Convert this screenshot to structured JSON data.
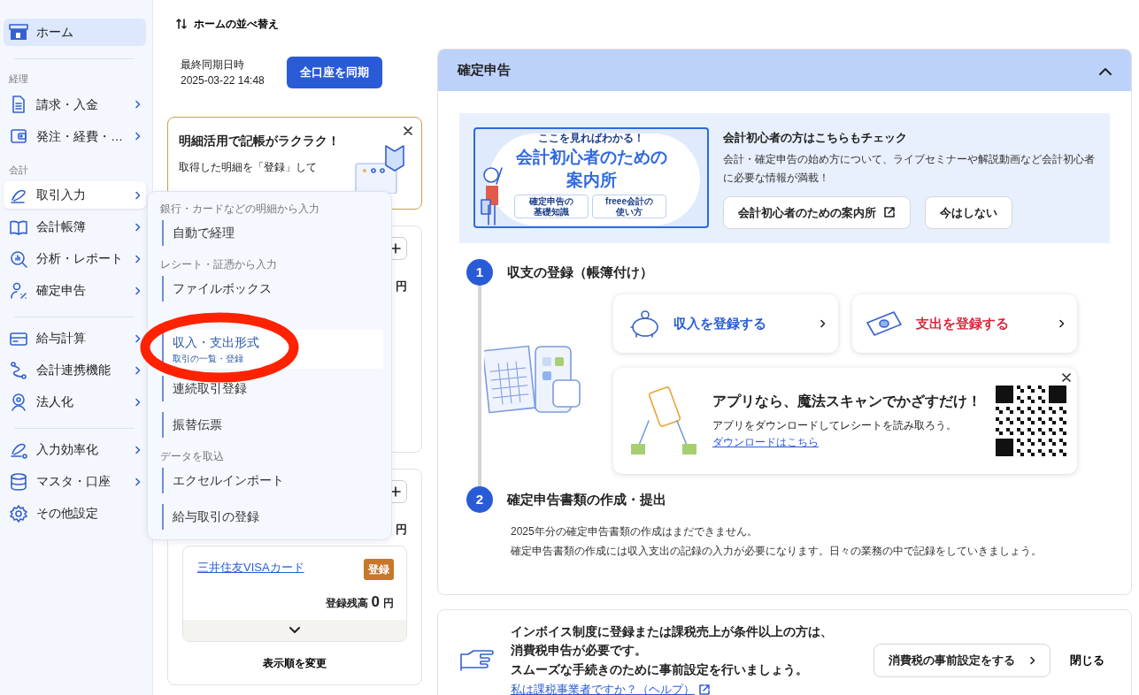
{
  "sidebar": {
    "groups": [
      {
        "items": [
          {
            "label": "ホーム",
            "selected": true,
            "expanded": false,
            "chevron": false
          }
        ]
      },
      {
        "label": "経理",
        "items": [
          {
            "label": "請求・入金",
            "selected": false,
            "expanded": false,
            "chevron": true
          },
          {
            "label": "発注・経費・…",
            "selected": false,
            "expanded": false,
            "chevron": true
          }
        ]
      },
      {
        "label": "会計",
        "items": [
          {
            "label": "取引入力",
            "selected": false,
            "expanded": true,
            "chevron": true
          },
          {
            "label": "会計帳簿",
            "selected": false,
            "expanded": false,
            "chevron": true
          },
          {
            "label": "分析・レポート",
            "selected": false,
            "expanded": false,
            "chevron": true
          },
          {
            "label": "確定申告",
            "selected": false,
            "expanded": false,
            "chevron": true
          }
        ]
      },
      {
        "items": [
          {
            "label": "給与計算",
            "selected": false,
            "expanded": false,
            "chevron": true
          },
          {
            "label": "会計連携機能",
            "selected": false,
            "expanded": false,
            "chevron": true
          },
          {
            "label": "法人化",
            "selected": false,
            "expanded": false,
            "chevron": true
          }
        ]
      },
      {
        "items": [
          {
            "label": "入力効率化",
            "selected": false,
            "expanded": false,
            "chevron": true
          },
          {
            "label": "マスタ・口座",
            "selected": false,
            "expanded": false,
            "chevron": true
          },
          {
            "label": "その他設定",
            "selected": false,
            "expanded": false,
            "chevron": false
          }
        ]
      }
    ]
  },
  "submenu": {
    "sections": [
      {
        "label": "銀行・カードなどの明細から入力",
        "items": [
          {
            "label": "自動で経理",
            "selected": false,
            "highlighted": false
          }
        ]
      },
      {
        "label": "レシート・証憑から入力",
        "items": [
          {
            "label": "ファイルボックス",
            "selected": false,
            "highlighted": false
          }
        ]
      },
      {
        "items": [
          {
            "label": "収入・支出形式",
            "sublabel": "取引の一覧・登録",
            "selected": true,
            "highlighted": true
          },
          {
            "label": "連続取引登録",
            "selected": false,
            "highlighted": false
          },
          {
            "label": "振替伝票",
            "selected": false,
            "highlighted": false
          }
        ]
      },
      {
        "label": "データを取込",
        "items": [
          {
            "label": "エクセルインポート",
            "selected": false,
            "highlighted": false
          },
          {
            "label": "給与取引の登録",
            "selected": false,
            "highlighted": false
          }
        ]
      }
    ]
  },
  "middle": {
    "sort_link": "ホームの並べ替え",
    "sync": {
      "label": "最終同期日時",
      "time": "2025-03-22 14:48",
      "button": "全口座を同期"
    },
    "banner": {
      "title": "明細活用で記帳がラクラク！",
      "text": "取得した明細を「登録」して"
    },
    "account_cards": [
      {
        "yen": "円"
      },
      {
        "yen": "円",
        "accounts": [
          {
            "name": "三井住友VISAカード",
            "badge": "登録",
            "balance_label": "登録残高",
            "balance": "0",
            "yen": "円"
          }
        ],
        "footer": "表示順を変更"
      }
    ]
  },
  "panel": {
    "title": "確定申告",
    "expanded": true,
    "guide": {
      "image": {
        "kicker": "ここを見ればわかる！",
        "title": "会計初心者のための",
        "title_2": "案内所",
        "chips": [
          {
            "lines": [
              "確定申告の",
              "基礎知識"
            ]
          },
          {
            "lines": [
              "freee会計の",
              "使い方"
            ]
          }
        ]
      },
      "heading": "会計初心者の方はこちらもチェック",
      "text": "会計・確定申告の始め方について、ライブセミナーや解説動画など会計初心者に必要な情報が満載！",
      "buttons": [
        {
          "label": "会計初心者のための案内所",
          "kind": "external"
        },
        {
          "label": "今はしない",
          "kind": "plain"
        }
      ]
    },
    "steps": [
      {
        "number": "1",
        "title": "収支の登録（帳簿付け）"
      },
      {
        "number": "2",
        "title": "確定申告書類の作成・提出",
        "lines": [
          "2025年分の確定申告書類の作成はまだできません。",
          "確定申告書類の作成には収入支出の記録の入力が必要になります。日々の業務の中で記録をしていきましょう。"
        ]
      }
    ],
    "actions": [
      {
        "label": "収入を登録する",
        "kind": "income"
      },
      {
        "label": "支出を登録する",
        "kind": "expense"
      }
    ],
    "app_promo": {
      "title": "アプリなら、魔法スキャンでかざすだけ！",
      "text": "アプリをダウンロードしてレシートを読み取ろう。",
      "link": "ダウンロードはこちら"
    }
  },
  "invoice": {
    "lines": [
      "インボイス制度に登録または課税売上が条件以上の方は、",
      "消費税申告が必要です。",
      "スムーズな手続きのために事前設定を行いましょう。"
    ],
    "link": "私は課税事業者ですか？（ヘルプ）",
    "button": "消費税の事前設定をする",
    "close": "閉じる"
  }
}
